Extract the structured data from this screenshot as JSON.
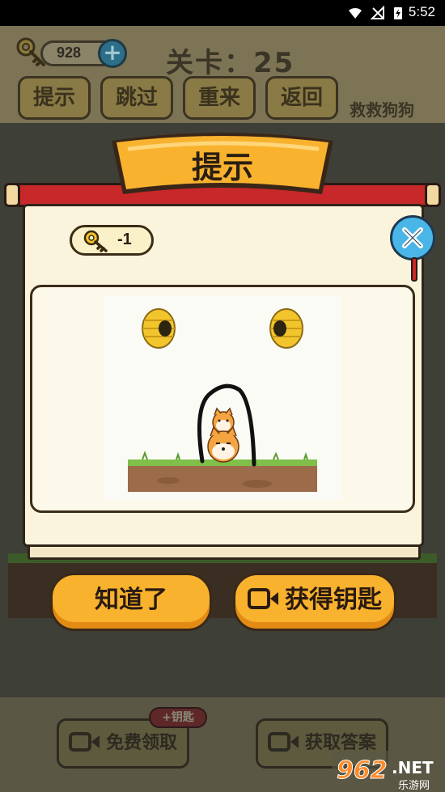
{
  "status_bar": {
    "time": "5:52"
  },
  "game": {
    "key_count": "928",
    "level": "关卡：25",
    "title": "救救狗狗",
    "top_buttons": [
      "提示",
      "跳过",
      "重来",
      "返回"
    ],
    "bottom_buttons": {
      "free_claim": "免费领取",
      "get_answer": "获取答案"
    },
    "badge": "+钥匙"
  },
  "dialog": {
    "title": "提示",
    "cost": "-1",
    "buttons": {
      "ok": "知道了",
      "get_key": "获得钥匙"
    }
  },
  "watermark": {
    "number": "962",
    "suffix": ".NET",
    "name": "乐游网"
  },
  "colors": {
    "accent_orange": "#f8b22e",
    "close_blue": "#4ab6e8",
    "rod_red": "#c8282a",
    "paper": "#fbf4dc"
  }
}
